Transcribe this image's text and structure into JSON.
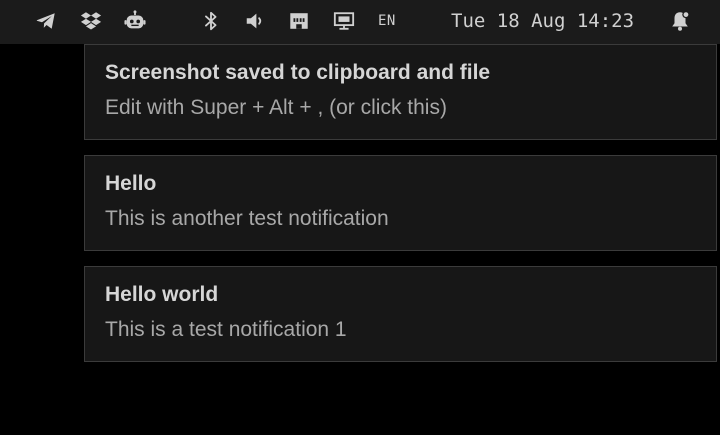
{
  "colors": {
    "bar_background": "#1b1b1b",
    "icon": "#d0d0d0",
    "desktop": "#000000",
    "notification_background": "#171717",
    "notification_border": "#3b3b3b",
    "summary_text": "#d6d6d6",
    "body_text": "#a8a8a8"
  },
  "top_bar": {
    "tray_icons": [
      {
        "name": "telegram-icon"
      },
      {
        "name": "dropbox-icon"
      },
      {
        "name": "robot-icon"
      },
      {
        "name": "bluetooth-icon"
      },
      {
        "name": "volume-icon"
      },
      {
        "name": "network-icon"
      },
      {
        "name": "display-icon"
      }
    ],
    "keyboard_layout": "EN",
    "clock": "Tue 18 Aug 14:23",
    "notification_bell": "bell-icon"
  },
  "notifications": [
    {
      "summary": "Screenshot saved to clipboard and file",
      "body": "Edit with Super + Alt + , (or click this)"
    },
    {
      "summary": "Hello",
      "body": "This is another test notification"
    },
    {
      "summary": "Hello world",
      "body": "This is a test notification 1"
    }
  ]
}
